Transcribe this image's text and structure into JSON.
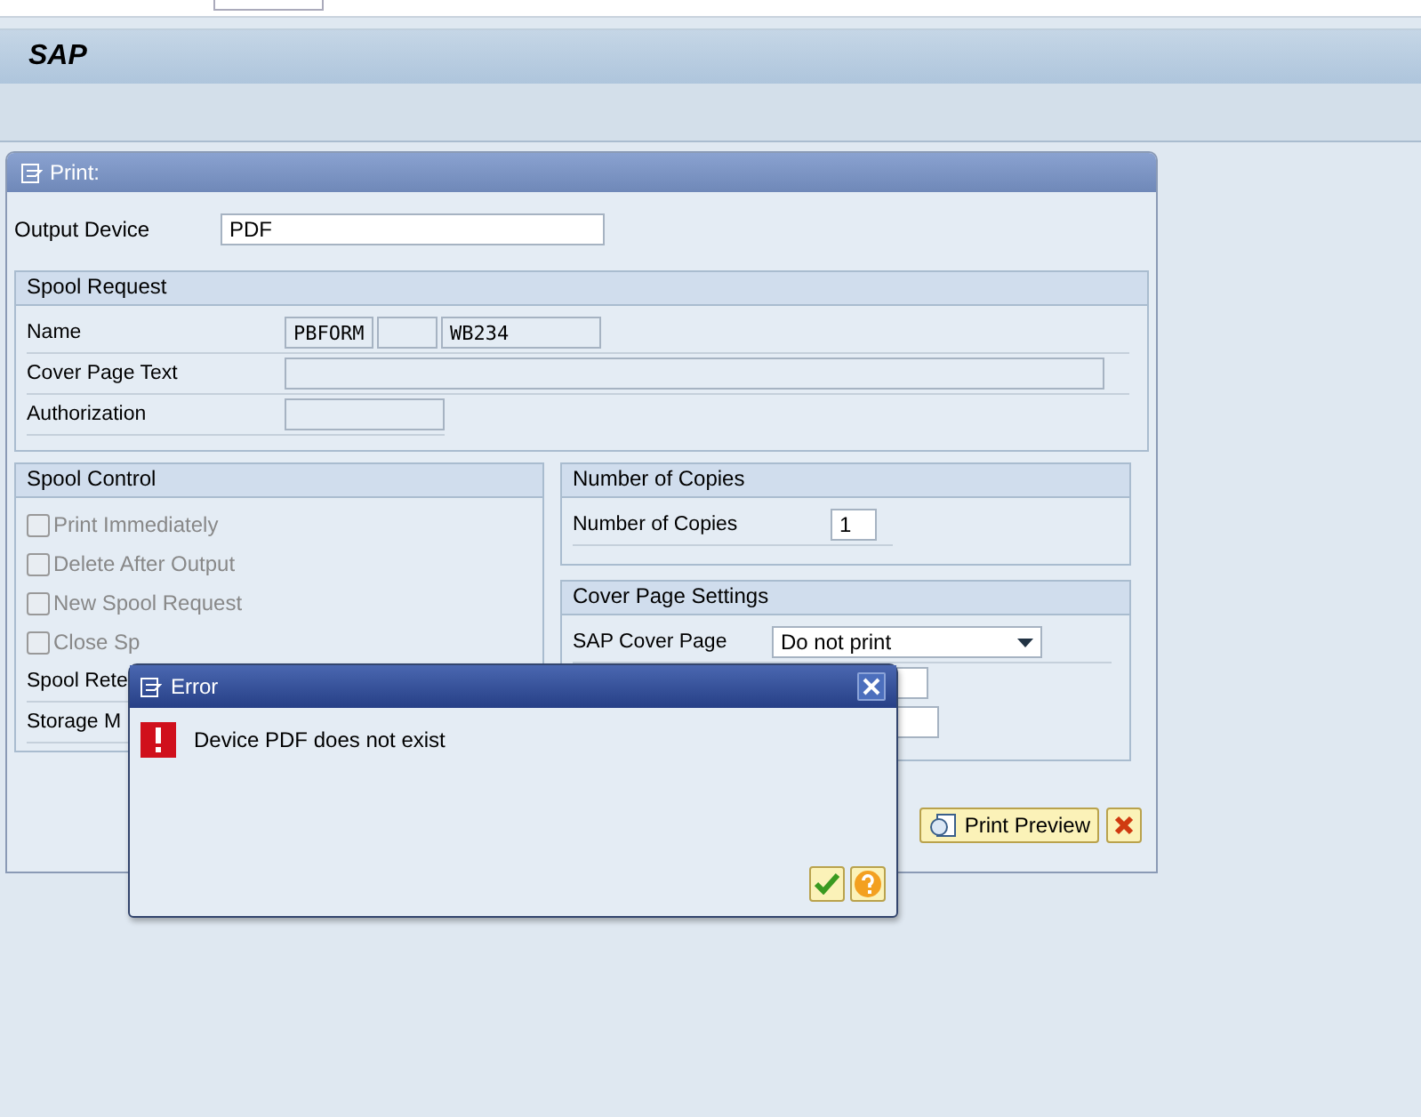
{
  "header": {
    "title": "SAP"
  },
  "print_dialog": {
    "title": "Print:",
    "output_device": {
      "label": "Output Device",
      "value": "PDF"
    },
    "spool_request": {
      "title": "Spool Request",
      "name_label": "Name",
      "name_values": [
        "PBFORM",
        "WB234"
      ],
      "cover_page_text_label": "Cover Page Text",
      "authorization_label": "Authorization"
    },
    "spool_control": {
      "title": "Spool Control",
      "options": [
        {
          "label": "Print Immediately",
          "checked": false,
          "disabled": true
        },
        {
          "label": "Delete After Output",
          "checked": false,
          "disabled": true
        },
        {
          "label": "New Spool Request",
          "checked": false,
          "disabled": true
        },
        {
          "label": "Close Sp",
          "checked": false,
          "disabled": true
        }
      ],
      "fields": [
        "Spool Rete",
        "Storage M"
      ]
    },
    "copies": {
      "title": "Number of Copies",
      "label": "Number of Copies",
      "value": "1"
    },
    "cover_page": {
      "title": "Cover Page Settings",
      "label": "SAP Cover Page",
      "value": "Do not print"
    },
    "buttons": [
      {
        "label": "Print Preview"
      }
    ]
  },
  "error_dialog": {
    "title": "Error",
    "message": "Device PDF does not exist"
  }
}
